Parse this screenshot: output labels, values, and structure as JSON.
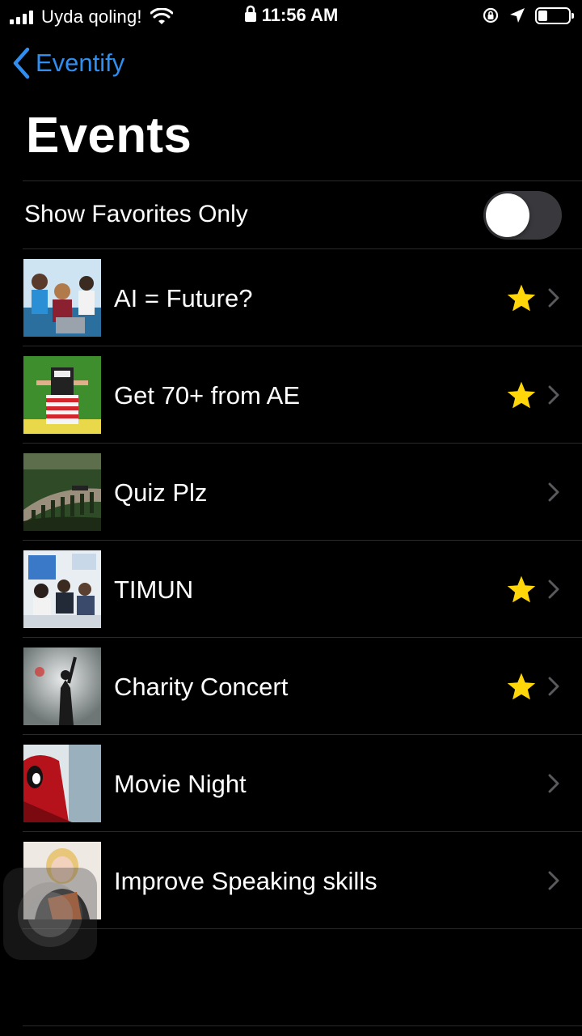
{
  "status_bar": {
    "carrier": "Uyda qoling!",
    "time": "11:56 AM",
    "battery_level": 0.3
  },
  "nav": {
    "back_label": "Eventify",
    "title": "Events"
  },
  "favorites_toggle": {
    "label": "Show Favorites Only",
    "on": false
  },
  "events": [
    {
      "title": "AI = Future?",
      "favorite": true,
      "thumb_icon": "photo-group-laptop"
    },
    {
      "title": "Get 70+ from AE",
      "favorite": true,
      "thumb_icon": "photo-reading-book"
    },
    {
      "title": "Quiz Plz",
      "favorite": false,
      "thumb_icon": "photo-viaduct-train"
    },
    {
      "title": "TIMUN",
      "favorite": true,
      "thumb_icon": "photo-conference"
    },
    {
      "title": "Charity Concert",
      "favorite": true,
      "thumb_icon": "photo-concert-singer"
    },
    {
      "title": "Movie Night",
      "favorite": false,
      "thumb_icon": "photo-deadpool"
    },
    {
      "title": "Improve Speaking skills",
      "favorite": false,
      "thumb_icon": "photo-speaker-woman"
    }
  ],
  "colors": {
    "accent": "#2f8ef0",
    "star": "#ffd60a",
    "chevron": "#5a5a5e",
    "separator": "#2a2a2c",
    "toggle_off": "#39393d"
  }
}
